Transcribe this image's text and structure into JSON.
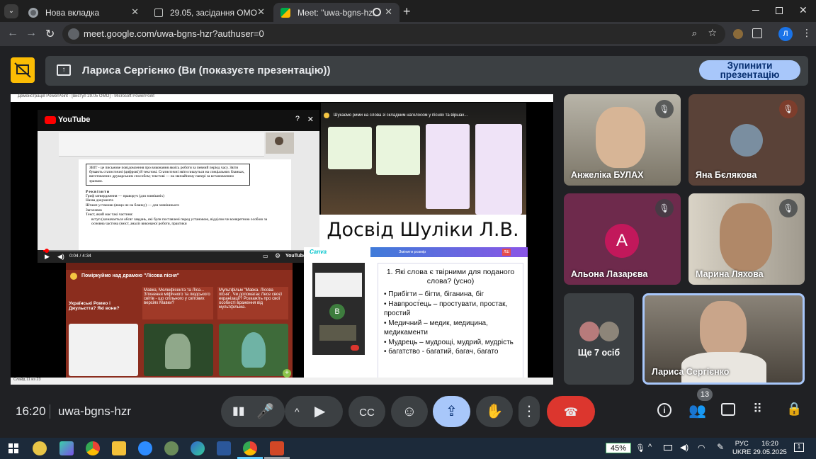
{
  "tabs": [
    {
      "title": "Нова вкладка"
    },
    {
      "title": "29.05, засідання ОМО"
    },
    {
      "title": "Meet: \"uwa-bgns-hzr\""
    }
  ],
  "address": {
    "url": "meet.google.com/uwa-bgns-hzr?authuser=0",
    "profile_initial": "Л"
  },
  "presenting": {
    "label": "Лариса Сергієнко (Ви (показуєте презентацію))",
    "stop_label": "Зупинити презентацію"
  },
  "slide": {
    "window_title": "Демонстрація PowerPoint - [виступ 29.05 ОМО] - Microsoft PowerPoint",
    "status_left": "Слайд 11 из 23",
    "youtube": {
      "brand": "YouTube",
      "time": "0:04 / 4:34",
      "brand_small": "YouTube"
    },
    "doc_text": {
      "heading": "ЗВІТ - це письмове повідомлення про виконання якоїсь роботи за певний період часу. Звіти бувають статистичні (цифрові) й текстові. Статистичні звіти пишуться на спеціальних бланках, виготовлених друкарським способом; текстові — на звичайному папері за встановленим зразком.",
      "req": "Реквізити",
      "lines": [
        "Гриф затвердження — праворуч (для зовнішніх)",
        "Назва документа",
        "Штамп установи (якщо не на бланку) — для зовнішнього",
        "Заголовок",
        "Текст, який має такі частини:",
        "вступ (зазначається обсяг завдань, які були поставлені перед установою, відділом чи конкретною особою за",
        "основна частина (зміст, аналіз виконаної роботи, практики"
      ]
    },
    "padlet_top": {
      "title": "Шукаємо рими на слова зі складним наголосом у піснях та віршах..."
    },
    "padlet_bottom": {
      "title": "Поміркуймо над драмою \"Лісова пісня\"",
      "card1": "Мавка, Мелюфісента та Ліса... Зіткнення міфічного та людського світів - що спільного у світових версіях Мавки?",
      "card2": "Мультфільм \"Мавка. Лісова пісня\". Чи допомагає Лесе своєї екранізації? Розкажіть про свої особисті враження від мультфільма.",
      "card0": "Українські Ромео і Джульєтта? Які вони?"
    },
    "big_title": "Досвід Шуліки Л.В.",
    "canva": {
      "brand": "Canva",
      "toolbar_label": "Змінити розмір",
      "question": "1. Які слова є твірними для поданого слова? (усно)",
      "items": [
        "Прибігти – бігти, біганина, біг",
        "Навпрост́ець – простувати, простак, простий",
        "Медичний – медик, медицина, медикаменти",
        "Мудрець – мудрощі, мудрий, мудрість",
        "багатство - багатий, багач, багато"
      ]
    },
    "mini_call_initial": "В"
  },
  "participants": [
    {
      "name": "Анжеліка БУЛАХ",
      "muted": true
    },
    {
      "name": "Яна Бєлякова",
      "muted": true
    },
    {
      "name": "Альона Лазарєва",
      "muted": true,
      "initial": "А"
    },
    {
      "name": "Марина Ляхова",
      "muted": true
    },
    {
      "name": "Ще 7 осіб"
    },
    {
      "name": "Лариса Сергієнко",
      "active_speaker": true
    }
  ],
  "controls": {
    "time": "16:20",
    "meeting_code": "uwa-bgns-hzr",
    "participants_badge": "13"
  },
  "taskbar": {
    "battery": "45%",
    "lang1": "РУС",
    "lang2": "UKRE",
    "clock_time": "16:20",
    "clock_date": "29.05.2025",
    "notif": "1"
  },
  "colors": {
    "accent": "#a8c7fa",
    "end_call": "#dc362e",
    "present_active": "#a8c7fa",
    "stop_bg": "#a8c7fa"
  }
}
